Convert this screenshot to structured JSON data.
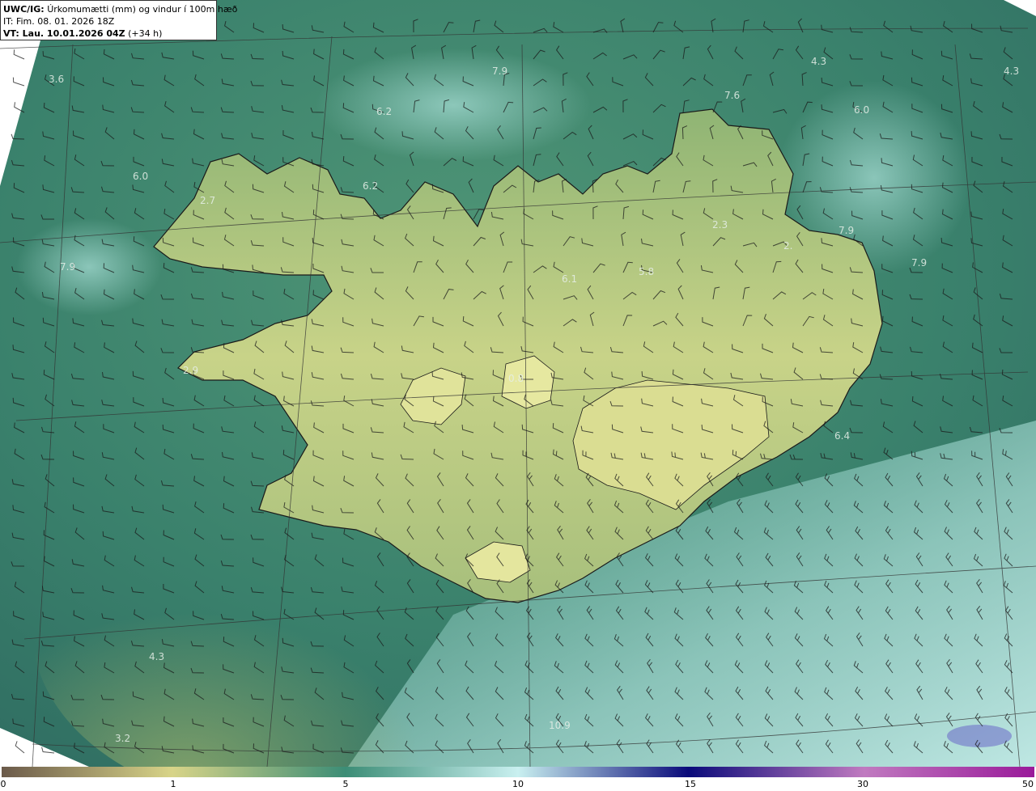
{
  "header": {
    "model_label": "UWC/IG:",
    "title": "Úrkomumætti (mm) og vindur í 100m hæð",
    "initial_time": "IT: Fim. 08. 01. 2026 18Z",
    "valid_time_label": "VT: Lau. 10.01.2026 04Z",
    "forecast_offset": "(+34 h)"
  },
  "colors": {
    "ocean_dark": "#2f6f62",
    "ocean_mid": "#3b8a74",
    "ocean_light": "#8fd0c6",
    "land_green": "#7aa869",
    "land_yellow": "#d6dc8c",
    "coast": "#1a1a1a",
    "barb": "#1a1a1a",
    "grid": "#333333"
  },
  "map_labels": [
    {
      "id": "v1",
      "text": "3.6"
    },
    {
      "id": "v2",
      "text": "7.9"
    },
    {
      "id": "v3",
      "text": "4.3"
    },
    {
      "id": "v4",
      "text": "4.3"
    },
    {
      "id": "v5",
      "text": "7.6"
    },
    {
      "id": "v6",
      "text": "6.0"
    },
    {
      "id": "v7",
      "text": "6.0"
    },
    {
      "id": "v8",
      "text": "6.2"
    },
    {
      "id": "v9",
      "text": "6.2"
    },
    {
      "id": "v10",
      "text": "2.7"
    },
    {
      "id": "v11",
      "text": "7.9"
    },
    {
      "id": "v12",
      "text": "2.3"
    },
    {
      "id": "v13",
      "text": "2."
    },
    {
      "id": "v14",
      "text": "7.9"
    },
    {
      "id": "v15",
      "text": "7.9"
    },
    {
      "id": "v16",
      "text": "6.1"
    },
    {
      "id": "v17",
      "text": "5.8"
    },
    {
      "id": "v18",
      "text": "2.9"
    },
    {
      "id": "v19",
      "text": "0.8"
    },
    {
      "id": "v20",
      "text": "6.4"
    },
    {
      "id": "v21",
      "text": "4.3"
    },
    {
      "id": "v22",
      "text": "3.2"
    },
    {
      "id": "v23",
      "text": "10.9"
    }
  ],
  "colorbar": {
    "ticks": [
      "0",
      "1",
      "5",
      "10",
      "15",
      "30",
      "50"
    ],
    "stops": [
      {
        "color": "#6b5a4a",
        "at": 0.0
      },
      {
        "color": "#d8d488",
        "at": 0.165
      },
      {
        "color": "#3c8d76",
        "at": 0.333
      },
      {
        "color": "#c9f0f0",
        "at": 0.5
      },
      {
        "color": "#0a0a7a",
        "at": 0.665
      },
      {
        "color": "#c07ac0",
        "at": 0.835
      },
      {
        "color": "#9a1a9a",
        "at": 1.0
      }
    ]
  }
}
